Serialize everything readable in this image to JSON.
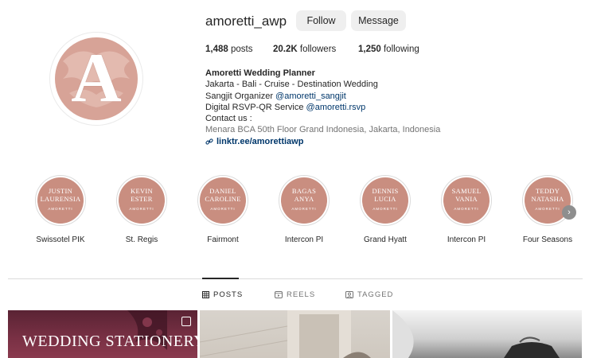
{
  "profile": {
    "username": "amoretti_awp",
    "follow_label": "Follow",
    "message_label": "Message",
    "avatar_letter": "A"
  },
  "stats": {
    "posts_count": "1,488",
    "posts_label": "posts",
    "followers_count": "20.2K",
    "followers_label": "followers",
    "following_count": "1,250",
    "following_label": "following"
  },
  "bio": {
    "name": "Amoretti Wedding Planner",
    "line1": "Jakarta - Bali - Cruise - Destination Wedding",
    "line2_prefix": "Sangjit Organizer ",
    "line2_mention": "@amoretti_sangjit",
    "line3_prefix": "Digital RSVP-QR Service ",
    "line3_mention": "@amoretti.rsvp",
    "line4": "Contact us :",
    "line5": "Menara BCA 50th Floor Grand Indonesia, Jakarta, Indonesia",
    "link": "linktr.ee/amorettiawp"
  },
  "highlights": [
    {
      "top": "JUSTIN",
      "bottom": "LAURENSIA",
      "sub": "AMORETTI",
      "label": "Swissotel PIK"
    },
    {
      "top": "KEVIN",
      "bottom": "ESTER",
      "sub": "AMORETTI",
      "label": "St. Regis"
    },
    {
      "top": "DANIEL",
      "bottom": "CAROLINE",
      "sub": "AMORETTI",
      "label": "Fairmont"
    },
    {
      "top": "BAGAS",
      "bottom": "ANYA",
      "sub": "AMORETTI",
      "label": "Intercon PI"
    },
    {
      "top": "DENNIS",
      "bottom": "LUCIA",
      "sub": "AMORETTI",
      "label": "Grand Hyatt"
    },
    {
      "top": "SAMUEL",
      "bottom": "VANIA",
      "sub": "AMORETTI",
      "label": "Intercon PI"
    },
    {
      "top": "TEDDY",
      "bottom": "NATASHA",
      "sub": "AMORETTI",
      "label": "Four Seasons"
    }
  ],
  "tabs": {
    "posts": "POSTS",
    "reels": "REELS",
    "tagged": "TAGGED"
  },
  "grid": {
    "tile1_title": "WEDDING STATIONERY"
  },
  "colors": {
    "brand_pink": "#d7a397",
    "highlight_fill": "#c98e80",
    "link_blue": "#00376b",
    "button_bg": "#efefef"
  }
}
